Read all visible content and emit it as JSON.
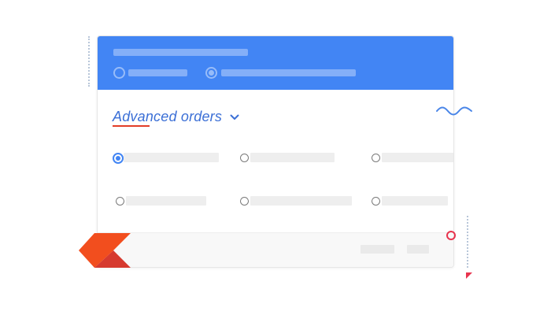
{
  "section": {
    "title": "Advanced orders",
    "expanded": true
  },
  "header": {
    "options": [
      {
        "selected": false
      },
      {
        "selected": true
      }
    ]
  },
  "order_options": [
    {
      "checked": true
    },
    {
      "checked": false
    },
    {
      "checked": false
    },
    {
      "checked": false
    },
    {
      "checked": false
    },
    {
      "checked": false
    }
  ],
  "icons": {
    "chevron": "chevron-down-icon",
    "wave": "wave-decoration-icon",
    "logo": "brand-logo-icon",
    "ring": "circle-decoration-icon",
    "triangle": "triangle-decoration-icon"
  },
  "colors": {
    "header_bg": "#4285f4",
    "accent": "#3b6fd6",
    "underline": "#e23d28",
    "logo_orange": "#f24e1e",
    "logo_red": "#d63a2f",
    "decoration_pink": "#e8344e"
  }
}
